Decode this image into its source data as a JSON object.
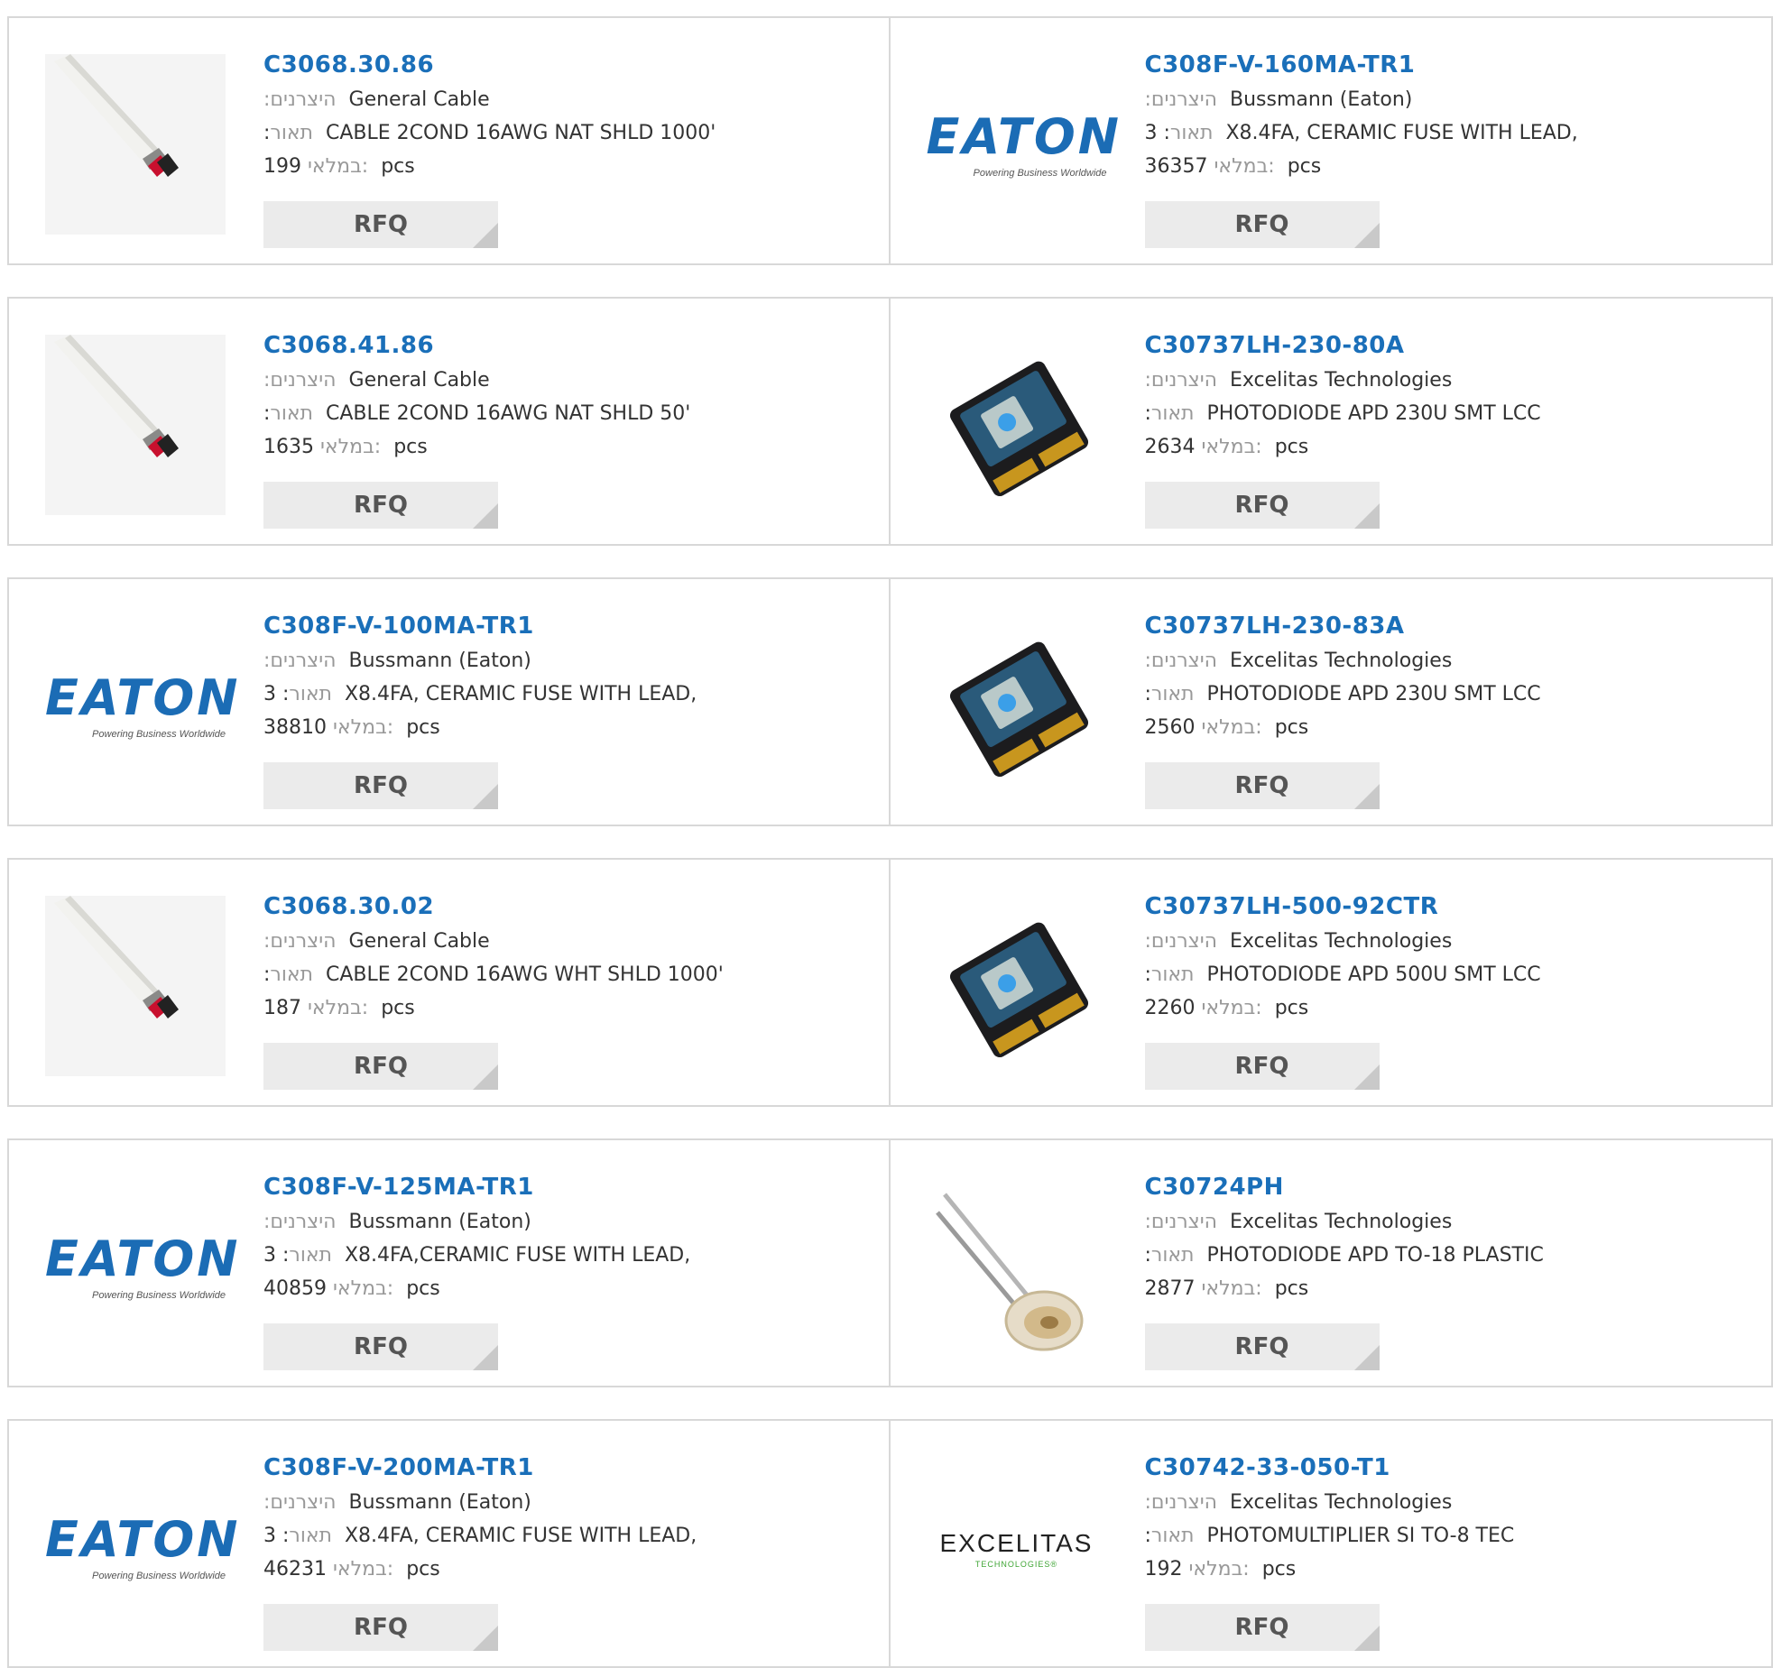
{
  "labels": {
    "manufacturer": ":היצרנים",
    "description": "תאור",
    "in_stock": "במלאי:",
    "pcs": "pcs",
    "rfq": "RFQ"
  },
  "rows": [
    {
      "left": {
        "part": "C3068.30.86",
        "manufacturer": "General Cable",
        "desc_prefix": ":",
        "description": "CABLE 2COND 16AWG NAT SHLD 1000'",
        "stock": "199",
        "image": "cable"
      },
      "right": {
        "part": "C308F-V-160MA-TR1",
        "manufacturer": "Bussmann (Eaton)",
        "desc_prefix": "3 :",
        "description": "X8.4FA, CERAMIC FUSE WITH LEAD,",
        "stock": "36357",
        "image": "eaton-logo"
      }
    },
    {
      "left": {
        "part": "C3068.41.86",
        "manufacturer": "General Cable",
        "desc_prefix": ":",
        "description": "CABLE 2COND 16AWG NAT SHLD 50'",
        "stock": "1635",
        "image": "cable"
      },
      "right": {
        "part": "C30737LH-230-80A",
        "manufacturer": "Excelitas Technologies",
        "desc_prefix": ":",
        "description": "PHOTODIODE APD 230U SMT LCC",
        "stock": "2634",
        "image": "photodiode-smt"
      }
    },
    {
      "left": {
        "part": "C308F-V-100MA-TR1",
        "manufacturer": "Bussmann (Eaton)",
        "desc_prefix": "3 :",
        "description": "X8.4FA, CERAMIC FUSE WITH LEAD,",
        "stock": "38810",
        "image": "eaton-logo"
      },
      "right": {
        "part": "C30737LH-230-83A",
        "manufacturer": "Excelitas Technologies",
        "desc_prefix": ":",
        "description": "PHOTODIODE APD 230U SMT LCC",
        "stock": "2560",
        "image": "photodiode-smt"
      }
    },
    {
      "left": {
        "part": "C3068.30.02",
        "manufacturer": "General Cable",
        "desc_prefix": ":",
        "description": "CABLE 2COND 16AWG WHT SHLD 1000'",
        "stock": "187",
        "image": "cable"
      },
      "right": {
        "part": "C30737LH-500-92CTR",
        "manufacturer": "Excelitas Technologies",
        "desc_prefix": ":",
        "description": "PHOTODIODE APD 500U SMT LCC",
        "stock": "2260",
        "image": "photodiode-smt"
      }
    },
    {
      "left": {
        "part": "C308F-V-125MA-TR1",
        "manufacturer": "Bussmann (Eaton)",
        "desc_prefix": "3 :",
        "description": "X8.4FA,CERAMIC FUSE WITH LEAD,",
        "stock": "40859",
        "image": "eaton-logo"
      },
      "right": {
        "part": "C30724PH",
        "manufacturer": "Excelitas Technologies",
        "desc_prefix": ":",
        "description": "PHOTODIODE APD TO-18 PLASTIC",
        "stock": "2877",
        "image": "photodiode-to18"
      }
    },
    {
      "left": {
        "part": "C308F-V-200MA-TR1",
        "manufacturer": "Bussmann (Eaton)",
        "desc_prefix": "3 :",
        "description": "X8.4FA, CERAMIC FUSE WITH LEAD,",
        "stock": "46231",
        "image": "eaton-logo"
      },
      "right": {
        "part": "C30742-33-050-T1",
        "manufacturer": "Excelitas Technologies",
        "desc_prefix": ":",
        "description": "PHOTOMULTIPLIER SI TO-8 TEC",
        "stock": "192",
        "image": "excelitas-logo"
      }
    }
  ],
  "logos": {
    "eaton": {
      "wordmark": "EATON",
      "tagline": "Powering Business Worldwide",
      "color": "#1b6cb5"
    },
    "excelitas": {
      "wordmark": "EXCELITAS",
      "tagline": "TECHNOLOGIES®",
      "tagline_color": "#3fa535"
    }
  },
  "colors": {
    "part_link": "#1a6fb9",
    "border": "#d8d8d8",
    "rfq_bg": "#ebebeb"
  }
}
